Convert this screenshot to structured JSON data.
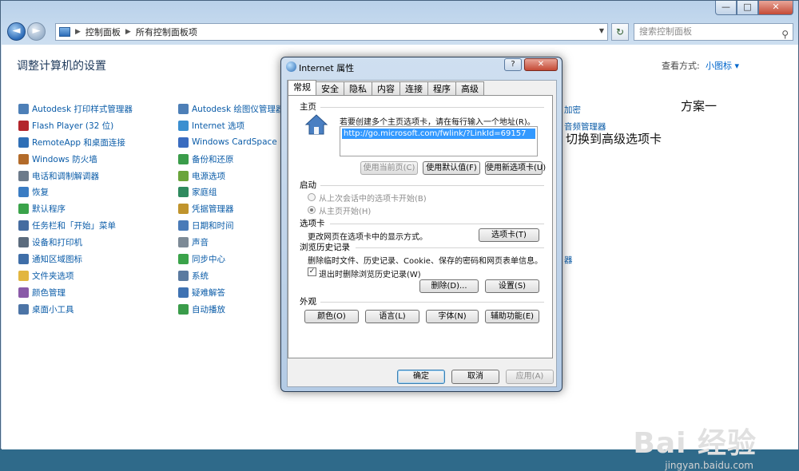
{
  "window": {
    "caption_buttons": [
      "—",
      "□",
      "✕"
    ]
  },
  "navbar": {
    "back": "◄",
    "forward": "►",
    "breadcrumbs": [
      "控制面板",
      "所有控制面板项"
    ],
    "search_placeholder": "搜索控制面板",
    "refresh": "↻"
  },
  "control_panel": {
    "title": "调整计算机的设置",
    "view_by_label": "查看方式:",
    "view_by_value": "小图标 ▾",
    "col1": [
      {
        "label": "Autodesk 打印样式管理器",
        "color": "#4d7fb7"
      },
      {
        "label": "Flash Player (32 位)",
        "color": "#b3252b"
      },
      {
        "label": "RemoteApp 和桌面连接",
        "color": "#2f6fb6"
      },
      {
        "label": "Windows 防火墙",
        "color": "#b36b2a"
      },
      {
        "label": "电话和调制解调器",
        "color": "#6c7a8a"
      },
      {
        "label": "恢复",
        "color": "#3a7cc3"
      },
      {
        "label": "默认程序",
        "color": "#3aa34a"
      },
      {
        "label": "任务栏和「开始」菜单",
        "color": "#456ca0"
      },
      {
        "label": "设备和打印机",
        "color": "#5b6b7d"
      },
      {
        "label": "通知区域图标",
        "color": "#3f6ea8"
      },
      {
        "label": "文件夹选项",
        "color": "#e2b640"
      },
      {
        "label": "颜色管理",
        "color": "#8a5aa8"
      },
      {
        "label": "桌面小工具",
        "color": "#4c74a6"
      }
    ],
    "col2": [
      {
        "label": "Autodesk 绘图仪管理器",
        "color": "#4d7fb7"
      },
      {
        "label": "Internet 选项",
        "color": "#3a8fd0"
      },
      {
        "label": "Windows CardSpace",
        "color": "#3a6cc0"
      },
      {
        "label": "备份和还原",
        "color": "#3a9c4a"
      },
      {
        "label": "电源选项",
        "color": "#6aa43a"
      },
      {
        "label": "家庭组",
        "color": "#2f8a5e"
      },
      {
        "label": "凭据管理器",
        "color": "#c0942d"
      },
      {
        "label": "日期和时间",
        "color": "#4a7bb8"
      },
      {
        "label": "声音",
        "color": "#7d8a96"
      },
      {
        "label": "同步中心",
        "color": "#3aa34a"
      },
      {
        "label": "系统",
        "color": "#5a7aa0"
      },
      {
        "label": "疑难解答",
        "color": "#3f72b2"
      },
      {
        "label": "自动播放",
        "color": "#3a9c4a"
      }
    ],
    "partial_col3": [
      "加密",
      "音频管理器",
      "器"
    ]
  },
  "dialog": {
    "title": "Internet 属性",
    "help": "?",
    "close": "✕",
    "tabs": [
      "常规",
      "安全",
      "隐私",
      "内容",
      "连接",
      "程序",
      "高级"
    ],
    "homepage": {
      "group": "主页",
      "desc": "若要创建多个主页选项卡，请在每行输入一个地址(R)。",
      "url": "http://go.microsoft.com/fwlink/?LinkId=69157",
      "btn_current": "使用当前页(C)",
      "btn_default": "使用默认值(F)",
      "btn_newtab": "使用新选项卡(U)"
    },
    "startup": {
      "group": "启动",
      "opt1": "从上次会话中的选项卡开始(B)",
      "opt2": "从主页开始(H)"
    },
    "tabs_group": {
      "group": "选项卡",
      "desc": "更改网页在选项卡中的显示方式。",
      "btn": "选项卡(T)"
    },
    "history": {
      "group": "浏览历史记录",
      "desc": "删除临时文件、历史记录、Cookie、保存的密码和网页表单信息。",
      "checkbox": "退出时删除浏览历史记录(W)",
      "btn_delete": "删除(D)...",
      "btn_settings": "设置(S)"
    },
    "appearance": {
      "group": "外观",
      "btn_colors": "颜色(O)",
      "btn_languages": "语言(L)",
      "btn_fonts": "字体(N)",
      "btn_accessibility": "辅助功能(E)"
    },
    "ok": "确定",
    "cancel": "取消",
    "apply": "应用(A)"
  },
  "annotations": {
    "plan": "方案一",
    "note": "切换到高级选项卡",
    "arrow_color": "#e53030"
  },
  "watermark": {
    "brand": "Bai 经验",
    "url": "jingyan.baidu.com"
  }
}
